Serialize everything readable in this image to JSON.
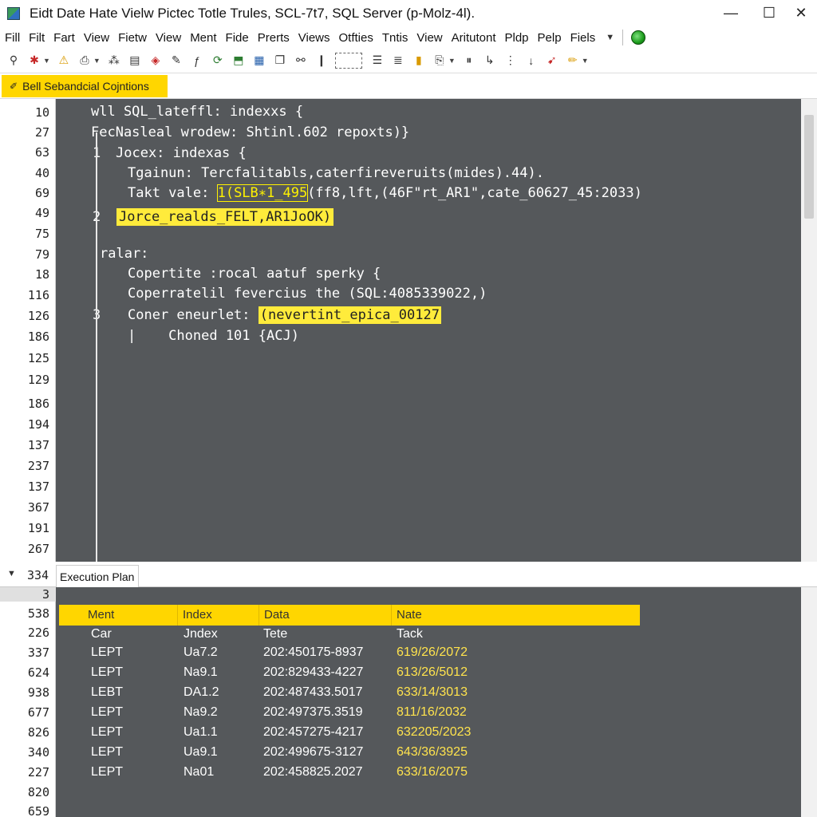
{
  "window": {
    "title": "Eidt  Date  Hate  Vielw  Pictec  Totle  Trules, SCL-7t7, SQL Server (p-Molz-4l).",
    "minimize": "—",
    "maximize": "☐",
    "close": "✕"
  },
  "menu": {
    "items": [
      "Fill",
      "Filt",
      "Fart",
      "View",
      "Fietw",
      "View",
      "Ment",
      "Fide",
      "Prerts",
      "Views",
      "Otfties",
      "Tntis",
      "View",
      "Aritutont",
      "Pldp",
      "Pelp",
      "Fiels"
    ]
  },
  "query_tab": {
    "label": "Bell Sebandcial Cojntions"
  },
  "editor": {
    "line_numbers": [
      "10",
      "27",
      "63",
      "40",
      "69",
      "49",
      "75",
      "79",
      "18",
      "116",
      "126",
      "186",
      "125",
      "129",
      "186",
      "194",
      "137",
      "237",
      "137",
      "367",
      "191",
      "267"
    ],
    "lines": [
      {
        "marker": "",
        "text": "wll SQL_lateffl: indexxs {"
      },
      {
        "marker": "",
        "text": "FecNasleal wrodew: Shtinl.602 repoxts)}"
      },
      {
        "marker": "1",
        "text": "Jocex: indexas {"
      },
      {
        "marker": "",
        "text": "Tgainun: Tercfalitabls,caterfireveruits(mides).44)."
      },
      {
        "marker": "",
        "text_pre": "Takt vale: ",
        "text_hl": "1(SLB∗1_495",
        "text_post": "(ff8,lft,(46F\"rt_AR1\",cate_60627_45:2033)"
      },
      {
        "marker": "2",
        "text_hl": "Jorce_realds_FELT,AR1JoOK)"
      },
      {
        "marker": "",
        "text": "ralar:"
      },
      {
        "marker": "",
        "text": "Copertite :rocal aatuf sperky {"
      },
      {
        "marker": "",
        "text": "Coperratelil fevercius the (SQL:4085339022,)"
      },
      {
        "marker": "3",
        "text_pre": "Coner eneurlet: ",
        "text_hl": "(nevertint_epica_00127"
      },
      {
        "marker": "",
        "text": "|    Choned 101 {ACJ)"
      }
    ]
  },
  "bottom": {
    "tab_label": "Execution Plan",
    "line_numbers": [
      "334",
      "3",
      "538",
      "226",
      "337",
      "624",
      "938",
      "677",
      "826",
      "340",
      "227",
      "820",
      "659"
    ]
  },
  "results": {
    "columns": [
      "Ment",
      "Index",
      "Data",
      "Nate"
    ],
    "rows": [
      [
        "Car",
        "Jndex",
        "Tete",
        "Tack"
      ],
      [
        "LEPT",
        "Ua7.2",
        "202:450175-8937",
        "619/26/2072"
      ],
      [
        "LEPT",
        "Na9.1",
        "202:829433-4227",
        "613/26/5012"
      ],
      [
        "LEBT",
        "DA1.2",
        "202:487433.5017",
        "633/14/3013"
      ],
      [
        "LEPT",
        "Na9.2",
        "202:497375.3519",
        "811/16/2032"
      ],
      [
        "LEPT",
        "Ua1.1",
        "202:457275-4217",
        "632205/2023"
      ],
      [
        "LEPT",
        "Ua9.1",
        "202:499675-3127",
        "643/36/3925"
      ],
      [
        "LEPT",
        "Na01",
        "202:458825.2027",
        "633/16/2075"
      ]
    ]
  },
  "colors": {
    "accent": "#ffd600",
    "editor_bg": "#55585b",
    "highlight_text": "#ffe34d"
  }
}
